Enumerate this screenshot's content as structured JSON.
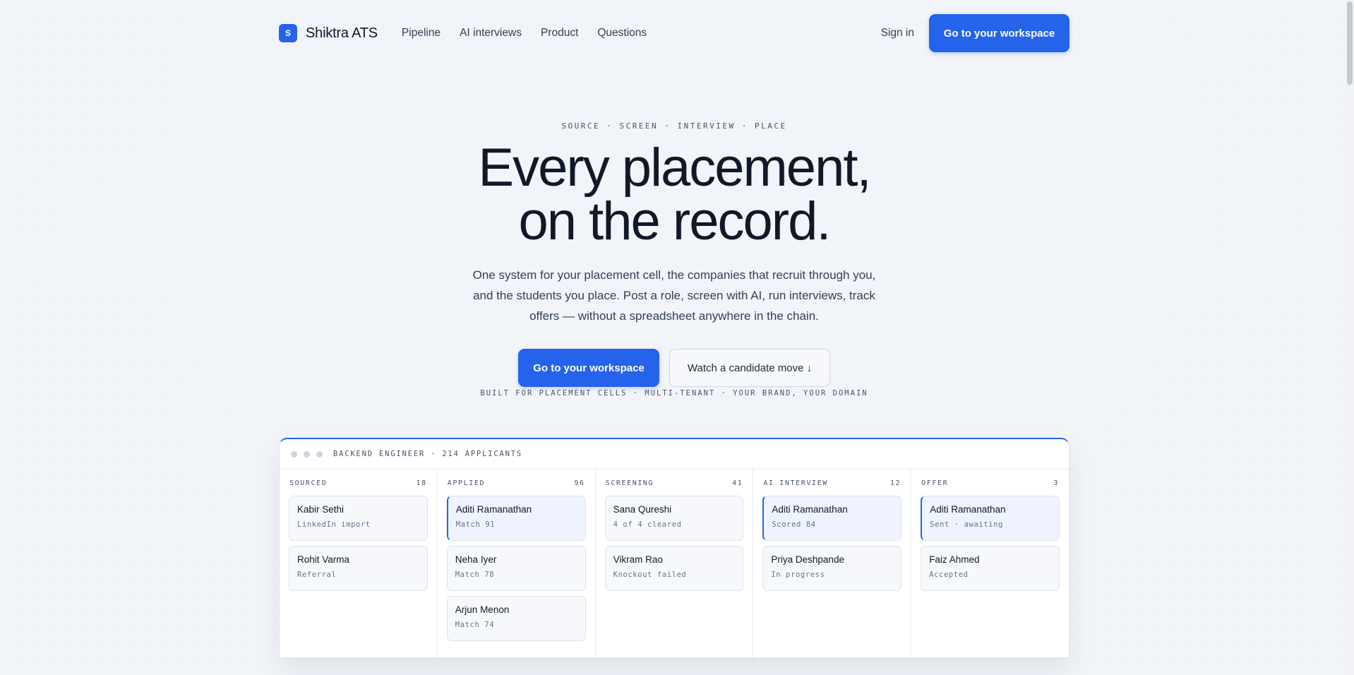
{
  "header": {
    "brand_initial": "S",
    "brand_name": "Shiktra ATS",
    "nav": [
      "Pipeline",
      "AI interviews",
      "Product",
      "Questions"
    ],
    "sign_in": "Sign in",
    "cta": "Go to your workspace"
  },
  "hero": {
    "eyebrow": "SOURCE · SCREEN · INTERVIEW · PLACE",
    "headline_line1": "Every placement,",
    "headline_line2": "on the record.",
    "subtitle": "One system for your placement cell, the companies that recruit through you, and the students you place. Post a role, screen with AI, run interviews, track offers — without a spreadsheet anywhere in the chain.",
    "primary_cta": "Go to your workspace",
    "secondary_cta": "Watch a candidate move ↓",
    "fineprint": "BUILT FOR PLACEMENT CELLS · MULTI-TENANT · YOUR BRAND, YOUR DOMAIN"
  },
  "board": {
    "title": "BACKEND ENGINEER · 214 APPLICANTS",
    "columns": [
      {
        "name": "SOURCED",
        "count": "18",
        "cards": [
          {
            "name": "Kabir Sethi",
            "meta": "LinkedIn import"
          },
          {
            "name": "Rohit Varma",
            "meta": "Referral"
          }
        ]
      },
      {
        "name": "APPLIED",
        "count": "96",
        "cards": [
          {
            "name": "Aditi Ramanathan",
            "meta": "Match 91"
          },
          {
            "name": "Neha Iyer",
            "meta": "Match 78"
          },
          {
            "name": "Arjun Menon",
            "meta": "Match 74"
          }
        ]
      },
      {
        "name": "SCREENING",
        "count": "41",
        "cards": [
          {
            "name": "Sana Qureshi",
            "meta": "4 of 4 cleared"
          },
          {
            "name": "Vikram Rao",
            "meta": "Knockout failed"
          }
        ]
      },
      {
        "name": "AI INTERVIEW",
        "count": "12",
        "cards": [
          {
            "name": "Aditi Ramanathan",
            "meta": "Scored 84"
          },
          {
            "name": "Priya Deshpande",
            "meta": "In progress"
          }
        ]
      },
      {
        "name": "OFFER",
        "count": "3",
        "cards": [
          {
            "name": "Aditi Ramanathan",
            "meta": "Sent · awaiting"
          },
          {
            "name": "Faiz Ahmed",
            "meta": "Accepted"
          }
        ]
      }
    ]
  },
  "colors": {
    "accent": "#2563eb",
    "text": "#0f172a",
    "muted": "#475569",
    "background": "#f1f4f9"
  }
}
